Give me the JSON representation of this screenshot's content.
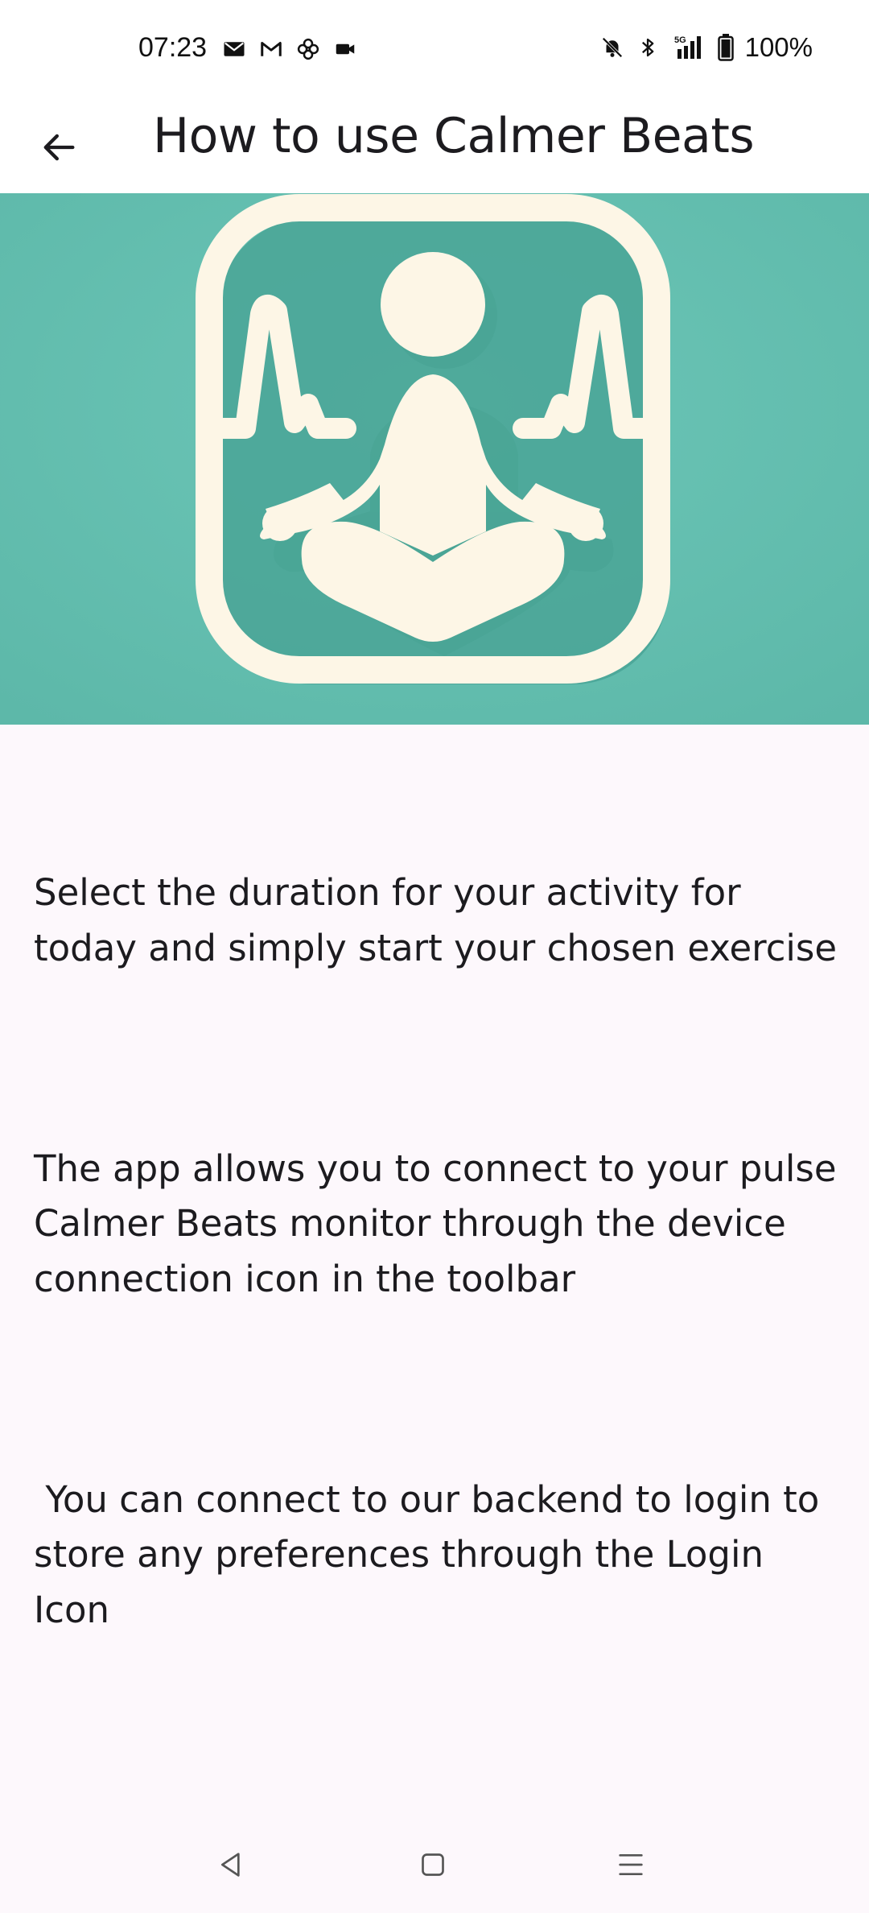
{
  "status_bar": {
    "time": "07:23",
    "battery": "100%",
    "left_icons": [
      "mail-icon",
      "gmail-icon",
      "pinwheel-icon",
      "video-camera-icon"
    ],
    "right_icons": [
      "bell-off-icon",
      "bluetooth-icon",
      "signal-5g-icon",
      "battery-icon"
    ]
  },
  "app_bar": {
    "title": "How to use Calmer Beats",
    "back_icon": "arrow-back-icon"
  },
  "hero": {
    "icon": "meditation-heartbeat-logo",
    "background_color": "#63bfb0",
    "foreground_color": "#fdf6e6"
  },
  "content": {
    "paragraphs": [
      "Select the duration for your activity for today and simply start your chosen exercise",
      "The app allows you to connect to your pulse Calmer Beats monitor through the device connection icon in the toolbar",
      " You can connect to our backend to login to store any preferences through the Login Icon"
    ]
  },
  "nav_bar": {
    "buttons": [
      "back-triangle-icon",
      "home-square-icon",
      "recents-menu-icon"
    ]
  }
}
